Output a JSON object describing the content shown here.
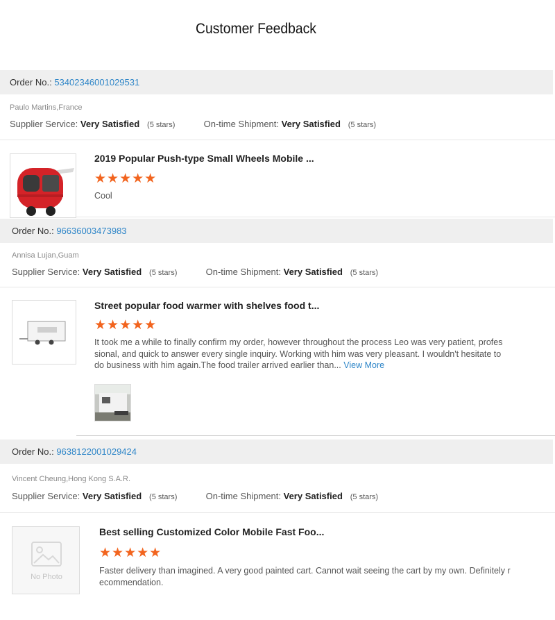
{
  "page": {
    "title": "Customer Feedback"
  },
  "labels": {
    "order_no": "Order No.:",
    "supplier_service": "Supplier Service:",
    "ontime_shipment": "On-time Shipment:"
  },
  "colors": {
    "accent": "#2f86c8",
    "star": "#f2641e",
    "bar": "#efefef"
  },
  "feedbacks": [
    {
      "order_no": "53402346001029531",
      "customer": "Paulo Martins,France",
      "supplier_service": "Very Satisfied",
      "supplier_stars": "(5 stars)",
      "shipment": "Very Satisfied",
      "shipment_stars": "(5 stars)",
      "product_title": "2019 Popular Push-type Small Wheels Mobile ...",
      "rating": 5,
      "rating_stars": "★★★★★",
      "comment": "Cool",
      "thumbnail_icon": "red-food-cart-image"
    },
    {
      "order_no": "96636003473983",
      "customer": "Annisa Lujan,Guam",
      "supplier_service": "Very Satisfied",
      "supplier_stars": "(5 stars)",
      "shipment": "Very Satisfied",
      "shipment_stars": "(5 stars)",
      "product_title": "Street popular food warmer with shelves food t...",
      "rating": 5,
      "rating_stars": "★★★★★",
      "comment_lines": [
        "It took me a while to finally confirm my order, however throughout the process Leo was very patient, profes",
        "sional, and quick to answer every single inquiry. Working with him was very pleasant. I wouldn't hesitate to",
        "do business with him again.The food trailer arrived earlier than..."
      ],
      "view_more": "View More",
      "thumbnail_icon": "white-trailer-image",
      "photo_icon": "delivered-trailer-photo"
    },
    {
      "order_no": "9638122001029424",
      "customer": "Vincent Cheung,Hong Kong S.A.R.",
      "supplier_service": "Very Satisfied",
      "supplier_stars": "(5 stars)",
      "shipment": "Very Satisfied",
      "shipment_stars": "(5 stars)",
      "product_title": "Best selling Customized Color Mobile Fast Foo...",
      "rating": 5,
      "rating_stars": "★★★★★",
      "comment_lines": [
        "Faster delivery than imagined. A very good painted cart. Cannot wait seeing the cart by my own. Definitely r",
        "ecommendation."
      ],
      "no_photo_label": "No Photo",
      "thumbnail_icon": "no-photo-icon"
    }
  ]
}
